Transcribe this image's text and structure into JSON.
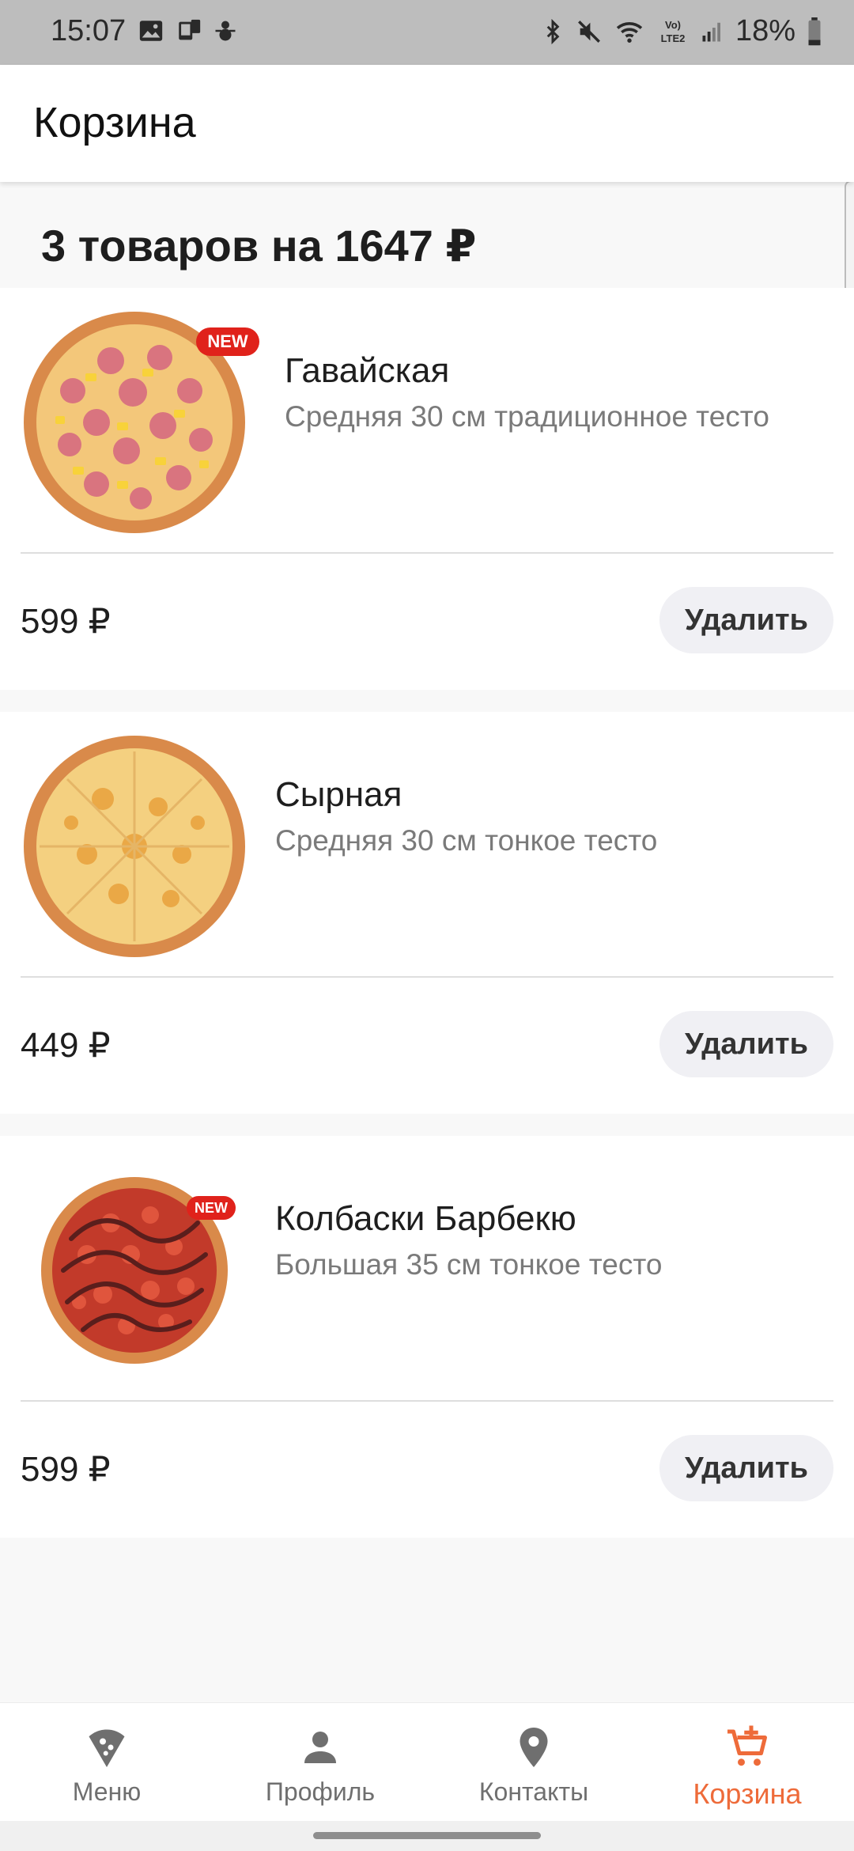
{
  "status_bar": {
    "time": "15:07",
    "battery": "18%",
    "left_icons": [
      "image-icon",
      "phone-transfer-icon",
      "snowman-icon"
    ],
    "right_icons": [
      "bluetooth-icon",
      "mute-icon",
      "wifi-icon",
      "volte-icon",
      "signal-icon",
      "battery-icon"
    ]
  },
  "app_bar": {
    "title": "Корзина"
  },
  "summary": {
    "text": "3 товаров на 1647 ₽"
  },
  "items": [
    {
      "name": "Гавайская",
      "description": "Средняя 30 см традиционное тесто",
      "price": "599 ₽",
      "is_new": true,
      "badge": "NEW",
      "delete_label": "Удалить"
    },
    {
      "name": "Сырная",
      "description": "Средняя 30 см тонкое тесто",
      "price": "449 ₽",
      "is_new": false,
      "delete_label": "Удалить"
    },
    {
      "name": "Колбаски Барбекю",
      "description": "Большая 35 см тонкое тесто",
      "price": "599 ₽",
      "is_new": true,
      "badge": "NEW",
      "delete_label": "Удалить"
    }
  ],
  "bottom_nav": [
    {
      "label": "Меню",
      "icon": "pizza-slice-icon",
      "active": false
    },
    {
      "label": "Профиль",
      "icon": "person-icon",
      "active": false
    },
    {
      "label": "Контакты",
      "icon": "location-pin-icon",
      "active": false
    },
    {
      "label": "Корзина",
      "icon": "cart-add-icon",
      "active": true
    }
  ],
  "colors": {
    "accent": "#ee6b3a",
    "badge": "#e0221b",
    "inactive_icon": "#6f6f6f"
  }
}
